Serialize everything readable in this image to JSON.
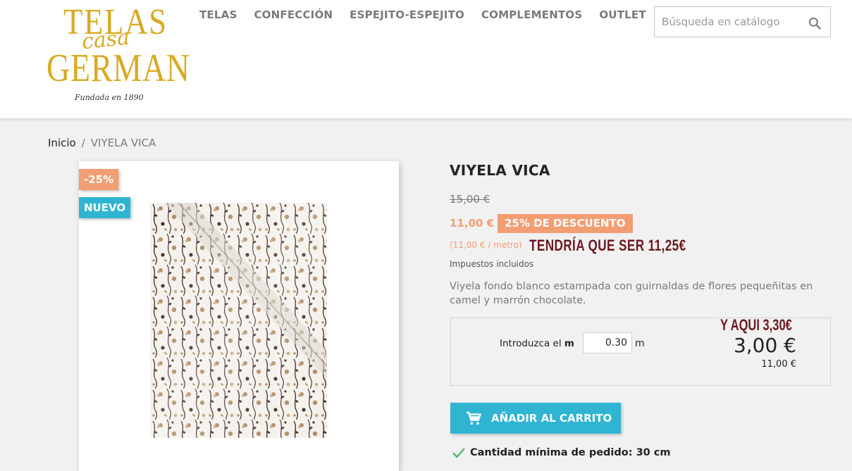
{
  "header": {
    "logo": {
      "line1": "TELAS",
      "script": "casa",
      "line2": "GERMAN",
      "founded": "Fundada en 1890"
    },
    "nav": [
      "TELAS",
      "CONFECCIÓN",
      "ESPEJITO-ESPEJITO",
      "COMPLEMENTOS",
      "OUTLET"
    ],
    "search": {
      "placeholder": "Búsqueda en catálogo",
      "icon": "search-icon"
    }
  },
  "breadcrumb": {
    "home": "Inicio",
    "separator": "/",
    "current": "VIYELA VICA"
  },
  "image_card": {
    "flag_discount": "-25%",
    "flag_new": "NUEVO",
    "image_alt": "Viyela fondo blanco estampada con guirnaldas de flores"
  },
  "product": {
    "title": "VIYELA VICA",
    "old_price": "15,00 €",
    "price": "11,00 €",
    "discount_label": "25% DE DESCUENTO",
    "unit_price": "(11,00 € / metro)",
    "annotation_1": "TENDRÍA QUE SER 11,25€",
    "tax": "Impuestos incluidos",
    "description": "Viyela fondo blanco estampada con guirnaldas de flores pequeñitas en camel y marrón chocolate."
  },
  "calculator": {
    "label_prefix": "Introduzca el ",
    "label_unit": "m",
    "value": "0.30",
    "unit": "m",
    "annotation_2": "Y AQUI 3,30€",
    "total": "3,00 €",
    "subtotal": "11,00 €"
  },
  "cart": {
    "button_label": "AÑADIR AL CARRITO",
    "icon": "cart-icon"
  },
  "min_order": {
    "icon": "check-icon",
    "text": "Cantidad mínima de pedido: 30 cm"
  },
  "colors": {
    "accent_blue": "#2fb5d2",
    "discount_orange": "#f39d72",
    "logo_gold": "#d9a921",
    "annotation_red": "#6b1a1f"
  }
}
